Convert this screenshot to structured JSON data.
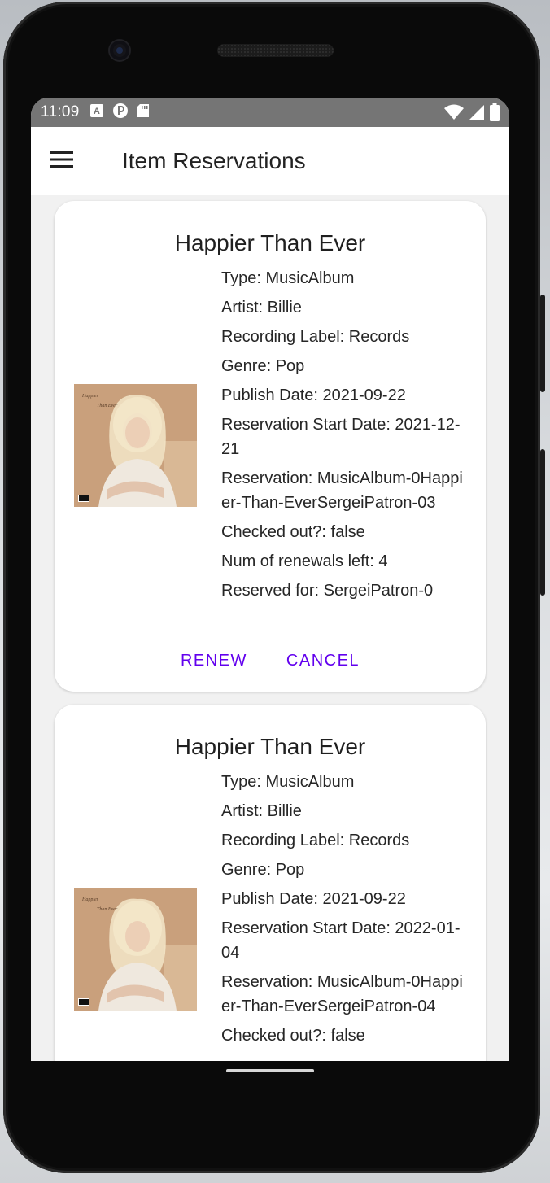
{
  "status_bar": {
    "time": "11:09"
  },
  "app_bar": {
    "title": "Item Reservations"
  },
  "reservations": [
    {
      "title": "Happier Than Ever",
      "type": "Type: MusicAlbum",
      "artist": "Artist: Billie",
      "label": "Recording Label: Records",
      "genre": "Genre: Pop",
      "publish_date": "Publish Date: 2021-09-22",
      "start_date": "Reservation Start Date: 2021-12-21",
      "reservation": "Reservation: MusicAlbum-0Happier-Than-EverSergeiPatron-03",
      "checked_out": "Checked out?: false",
      "renewals": "Num of renewals left: 4",
      "reserved_for": "Reserved for: SergeiPatron-0",
      "renew_label": "RENEW",
      "cancel_label": "CANCEL"
    },
    {
      "title": "Happier Than Ever",
      "type": "Type: MusicAlbum",
      "artist": "Artist: Billie",
      "label": "Recording Label: Records",
      "genre": "Genre: Pop",
      "publish_date": "Publish Date: 2021-09-22",
      "start_date": "Reservation Start Date: 2022-01-04",
      "reservation": "Reservation: MusicAlbum-0Happier-Than-EverSergeiPatron-04",
      "checked_out": "Checked out?: false"
    }
  ],
  "colors": {
    "accent": "#6200ee",
    "status_bar": "#757575",
    "app_bar": "#ffffff",
    "background": "#f1f1f1"
  },
  "icons": {
    "menu": "hamburger-menu-icon",
    "wifi": "wifi-icon",
    "signal": "signal-icon",
    "battery": "battery-icon"
  }
}
